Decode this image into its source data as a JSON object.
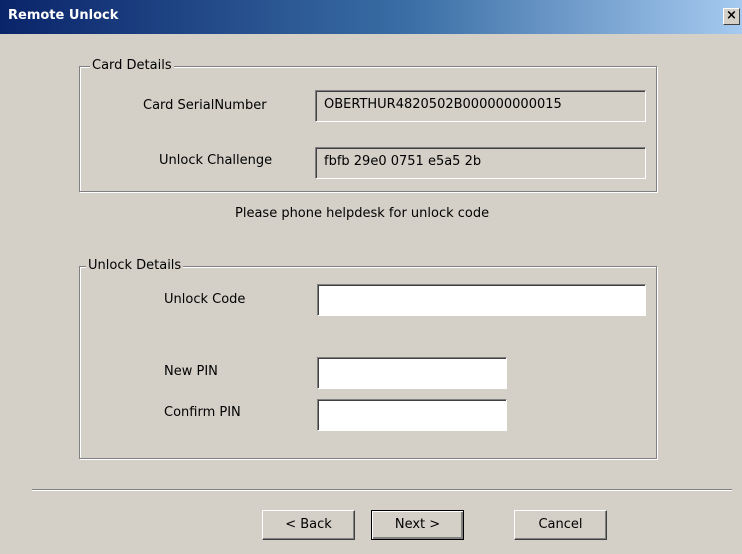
{
  "window": {
    "title": "Remote Unlock",
    "close_glyph": "×"
  },
  "card_details": {
    "legend": "Card Details",
    "serial_label": "Card SerialNumber",
    "serial_value": "OBERTHUR4820502B000000000015",
    "challenge_label": "Unlock Challenge",
    "challenge_value": "fbfb 29e0 0751 e5a5 2b"
  },
  "instruction": "Please phone helpdesk for unlock code",
  "unlock_details": {
    "legend": "Unlock Details",
    "unlock_code_label": "Unlock Code",
    "unlock_code_value": "",
    "new_pin_label": "New PIN",
    "new_pin_value": "",
    "confirm_pin_label": "Confirm PIN",
    "confirm_pin_value": ""
  },
  "buttons": {
    "back": "< Back",
    "next": "Next >",
    "cancel": "Cancel"
  }
}
